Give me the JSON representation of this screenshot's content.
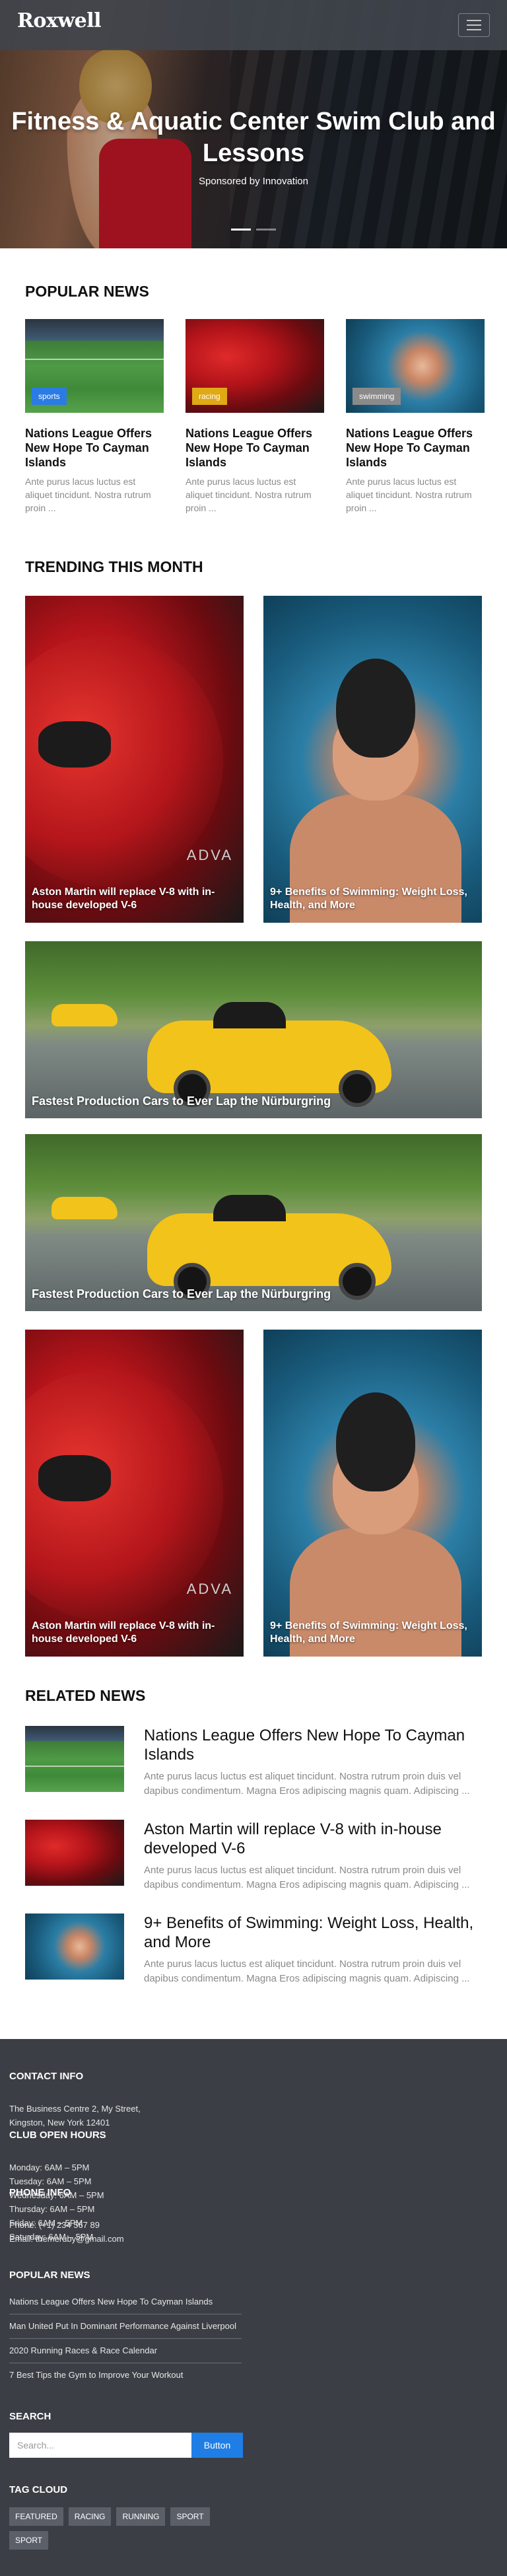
{
  "header": {
    "logo_text": "Roxwell",
    "menu_icon": "hamburger-icon"
  },
  "hero": {
    "title": "Fitness & Aquatic Center Swim Club and Lessons",
    "subtitle": "Sponsored by Innovation"
  },
  "popular": {
    "title": "POPULAR NEWS",
    "items": [
      {
        "badge": "sports",
        "badge_color": "#2b7be4",
        "title": "Nations League Offers New Hope To Cayman Islands",
        "text": "Ante purus lacus luctus est aliquet tincidunt. Nostra rutrum proin ..."
      },
      {
        "badge": "racing",
        "badge_color": "#e0a916",
        "title": "Nations League Offers New Hope To Cayman Islands",
        "text": "Ante purus lacus luctus est aliquet tincidunt. Nostra rutrum proin ..."
      },
      {
        "badge": "swimming",
        "badge_color": "#8a8a8a",
        "title": "Nations League Offers New Hope To Cayman Islands",
        "text": "Ante purus lacus luctus est aliquet tincidunt. Nostra rutrum proin ..."
      }
    ]
  },
  "trending": {
    "title": "TRENDING THIS MONTH",
    "items": [
      "Aston Martin will replace V-8 with in-house developed V-6",
      "9+ Benefits of Swimming: Weight Loss, Health, and More",
      "Fastest Production Cars to Ever Lap the Nürburgring",
      "Fastest Production Cars to Ever Lap the Nürburgring",
      "Aston Martin will replace V-8 with in-house developed V-6",
      "9+ Benefits of Swimming: Weight Loss, Health, and More"
    ],
    "car_badge": "ADVA"
  },
  "related": {
    "title": "RELATED NEWS",
    "items": [
      {
        "title": "Nations League Offers New Hope To Cayman Islands",
        "text": "Ante purus lacus luctus est aliquet tincidunt. Nostra rutrum proin duis vel dapibus condimentum. Magna Eros adipiscing magnis quam. Adipiscing ..."
      },
      {
        "title": "Aston Martin will replace V-8 with in-house developed V-6",
        "text": "Ante purus lacus luctus est aliquet tincidunt. Nostra rutrum proin duis vel dapibus condimentum. Magna Eros adipiscing magnis quam. Adipiscing ..."
      },
      {
        "title": "9+ Benefits of Swimming: Weight Loss, Health, and More",
        "text": "Ante purus lacus luctus est aliquet tincidunt. Nostra rutrum proin duis vel dapibus condimentum. Magna Eros adipiscing magnis quam. Adipiscing ..."
      }
    ]
  },
  "footer": {
    "contact_title": "CONTACT INFO",
    "contact_address": "The Business Centre 2, My Street, Kingston, New York 12401",
    "hours_title": "CLUB OPEN HOURS",
    "hours": [
      "Monday: 6AM – 5PM",
      "Tuesday: 6AM – 5PM",
      "Wednesday: 6AM – 5PM",
      "Thursday: 6AM – 5PM",
      "Friday: 6AM – 5PM",
      "Saturday: 6AM – 5PM"
    ],
    "phone_title": "PHONE INFO",
    "phone": "Phone: (+1) 234 567 89",
    "email": "Email: themeruby@gmail.com",
    "news_title": "POPULAR NEWS",
    "news": [
      "Nations League Offers New Hope To Cayman Islands",
      "Man United Put In Dominant Performance Against Liverpool",
      "2020 Running Races & Race Calendar",
      "7 Best Tips the Gym to Improve Your Workout"
    ],
    "search_title": "SEARCH",
    "search_placeholder": "Search...",
    "search_button": "Button",
    "tags_title": "TAG CLOUD",
    "tags": [
      "FEATURED",
      "RACING",
      "RUNNING",
      "SPORT",
      "SPORT"
    ]
  }
}
